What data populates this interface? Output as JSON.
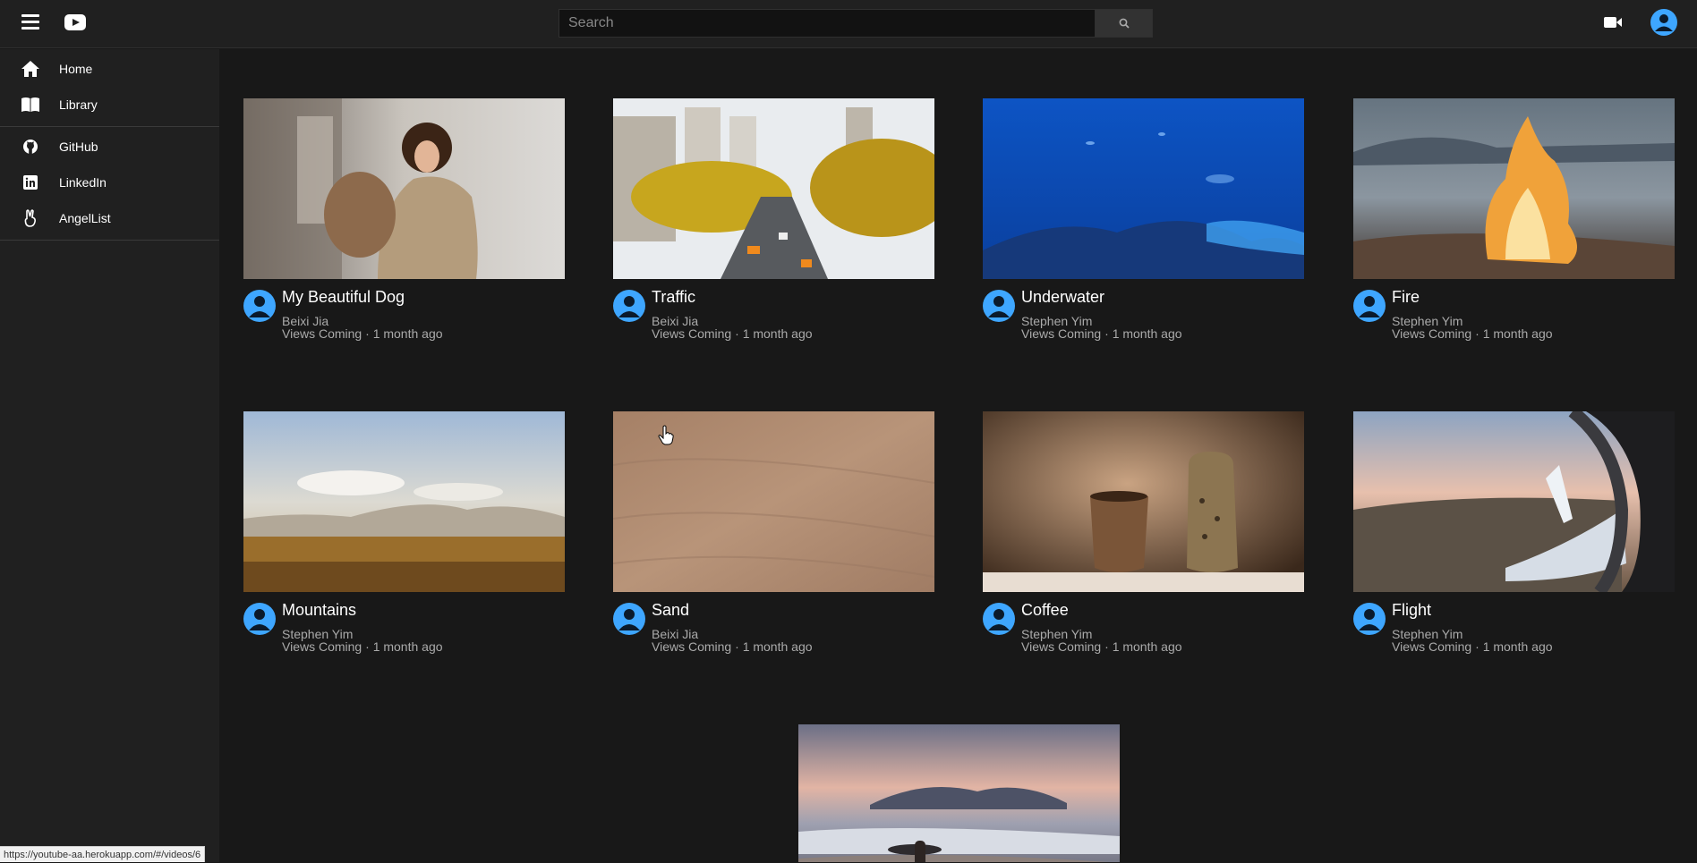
{
  "header": {
    "search_placeholder": "Search"
  },
  "sidebar": {
    "main_items": [
      {
        "label": "Home",
        "icon": "home-icon"
      },
      {
        "label": "Library",
        "icon": "library-icon"
      }
    ],
    "link_items": [
      {
        "label": "GitHub",
        "icon": "github-icon"
      },
      {
        "label": "LinkedIn",
        "icon": "linkedin-icon"
      },
      {
        "label": "AngelList",
        "icon": "angellist-icon"
      }
    ]
  },
  "videos": [
    {
      "title": "My Beautiful Dog",
      "channel": "Beixi Jia",
      "views": "Views Coming",
      "age": "1 month ago"
    },
    {
      "title": "Traffic",
      "channel": "Beixi Jia",
      "views": "Views Coming",
      "age": "1 month ago"
    },
    {
      "title": "Underwater",
      "channel": "Stephen Yim",
      "views": "Views Coming",
      "age": "1 month ago"
    },
    {
      "title": "Fire",
      "channel": "Stephen Yim",
      "views": "Views Coming",
      "age": "1 month ago"
    },
    {
      "title": "Mountains",
      "channel": "Stephen Yim",
      "views": "Views Coming",
      "age": "1 month ago"
    },
    {
      "title": "Sand",
      "channel": "Beixi Jia",
      "views": "Views Coming",
      "age": "1 month ago"
    },
    {
      "title": "Coffee",
      "channel": "Stephen Yim",
      "views": "Views Coming",
      "age": "1 month ago"
    },
    {
      "title": "Flight",
      "channel": "Stephen Yim",
      "views": "Views Coming",
      "age": "1 month ago"
    }
  ],
  "stats_separator": "·",
  "status_url": "https://youtube-aa.herokuapp.com/#/videos/6",
  "colors": {
    "background": "#181818",
    "header": "#202020",
    "accent": "#3ea6ff",
    "secondary_text": "#aaaaaa"
  }
}
